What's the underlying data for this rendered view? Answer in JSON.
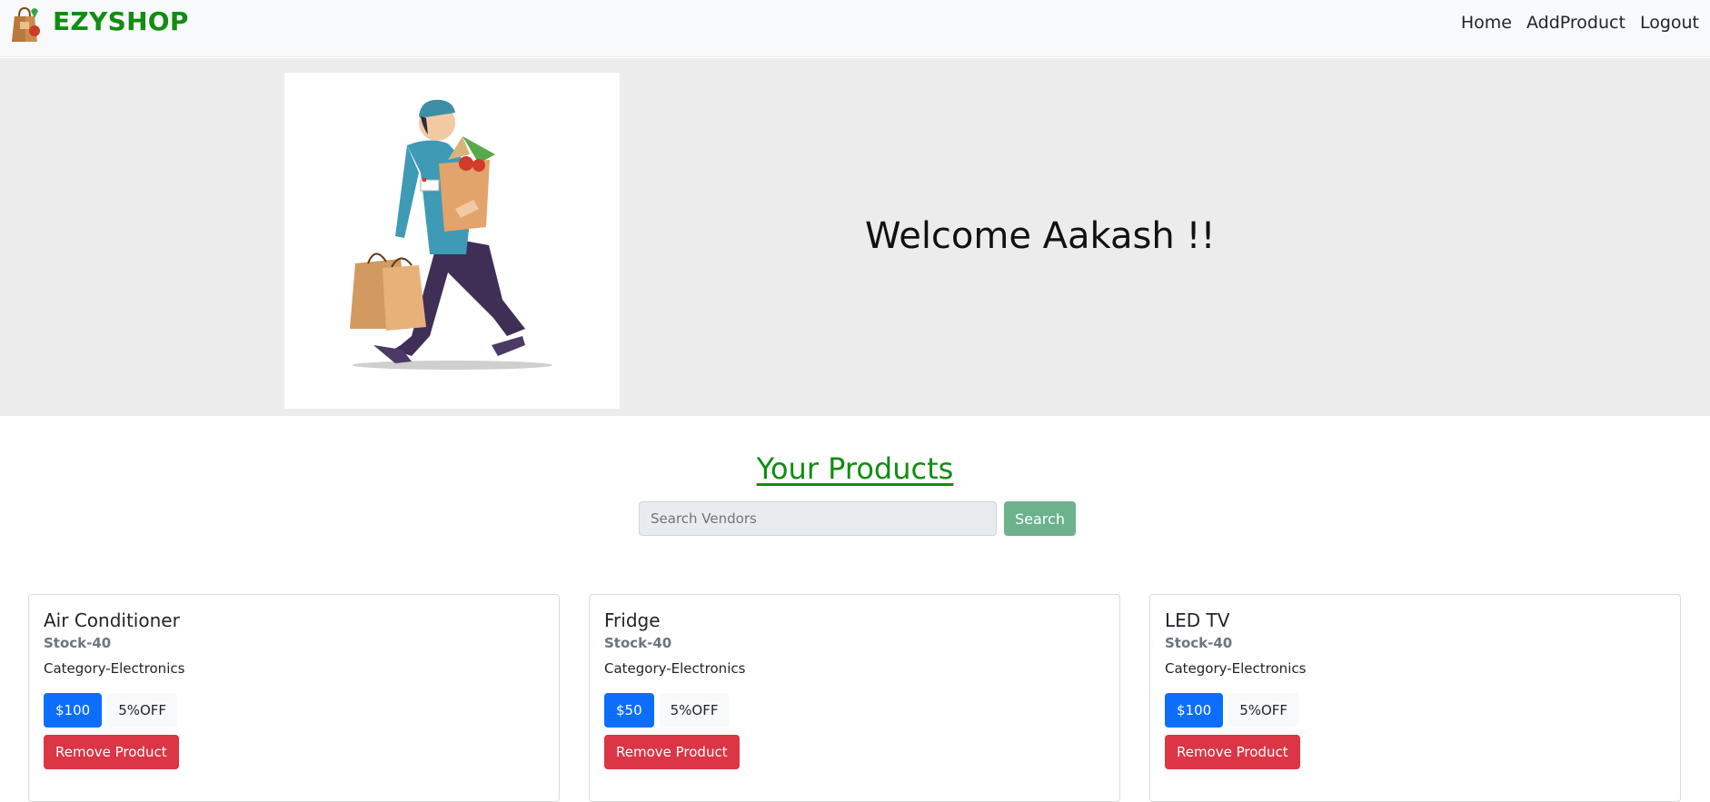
{
  "nav": {
    "brand": "EZYSHOP",
    "links": [
      "Home",
      "AddProduct",
      "Logout"
    ]
  },
  "hero": {
    "welcome": "Welcome Aakash !!"
  },
  "products_section": {
    "title": "Your Products",
    "search_placeholder": "Search Vendors",
    "search_button": "Search"
  },
  "products": [
    {
      "name": "Air Conditioner",
      "stock": "Stock-40",
      "category": "Category-Electronics",
      "price": "$100",
      "discount": "5%OFF",
      "remove": "Remove Product"
    },
    {
      "name": "Fridge",
      "stock": "Stock-40",
      "category": "Category-Electronics",
      "price": "$50",
      "discount": "5%OFF",
      "remove": "Remove Product"
    },
    {
      "name": "LED TV",
      "stock": "Stock-40",
      "category": "Category-Electronics",
      "price": "$100",
      "discount": "5%OFF",
      "remove": "Remove Product"
    }
  ],
  "colors": {
    "brand_green": "#128c12",
    "price_blue": "#0d6efd",
    "remove_red": "#dc3545",
    "search_green": "#6bb28d"
  }
}
